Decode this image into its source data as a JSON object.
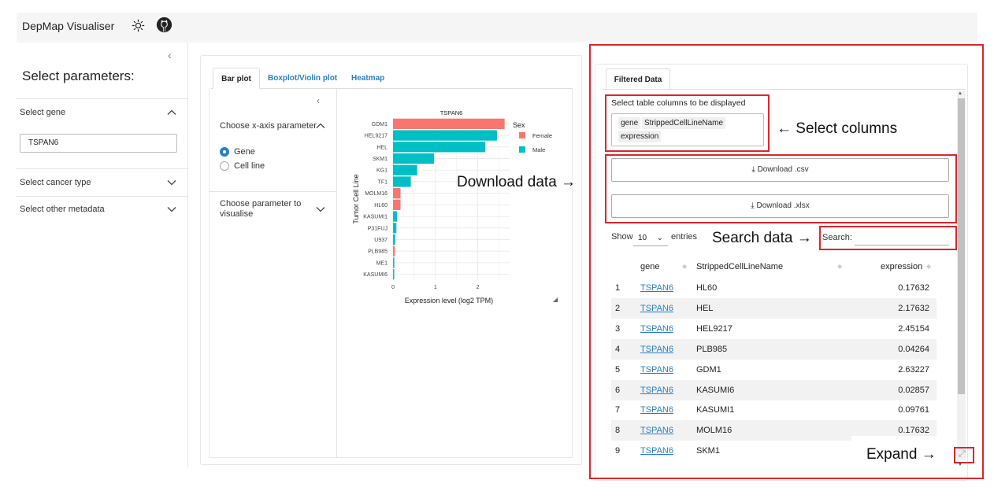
{
  "header": {
    "app_title": "DepMap Visualiser",
    "theme_icon": "sun-icon",
    "repo_icon": "github-icon"
  },
  "sidebar": {
    "heading": "Select parameters:",
    "gene_section": {
      "label": "Select gene",
      "value": "TSPAN6"
    },
    "cancer_section": {
      "label": "Select cancer type"
    },
    "metadata_section": {
      "label": "Select other metadata"
    }
  },
  "plot_panel": {
    "tabs": [
      "Bar plot",
      "Boxplot/Violin plot",
      "Heatmap"
    ],
    "active_tab": "Bar plot",
    "xaxis_option_label": "Choose x-axis parameter",
    "xaxis_options": [
      "Gene",
      "Cell line"
    ],
    "xaxis_selected": "Gene",
    "visualise_label": "Choose parameter to visualise"
  },
  "chart_data": {
    "type": "bar",
    "orientation": "horizontal",
    "title": "TSPAN6",
    "xlabel": "Expression level (log2 TPM)",
    "ylabel": "Tumor Cell Line",
    "xlim": [
      0,
      2.75
    ],
    "xticks": [
      "0",
      "1",
      "2"
    ],
    "categories": [
      "GDM1",
      "HEL9217",
      "HEL",
      "SKM1",
      "KG1",
      "TF1",
      "MOLM16",
      "HL60",
      "KASUMI1",
      "P31FUJ",
      "U937",
      "PLB985",
      "ME1",
      "KASUMI6"
    ],
    "values": [
      2.63227,
      2.45154,
      2.17632,
      0.97,
      0.57,
      0.42,
      0.17632,
      0.17632,
      0.09761,
      0.08,
      0.05,
      0.04264,
      0.03,
      0.02857
    ],
    "groups": [
      "Female",
      "Male",
      "Male",
      "Male",
      "Male",
      "Male",
      "Female",
      "Female",
      "Male",
      "Male",
      "Male",
      "Female",
      "Male",
      "Male"
    ],
    "legend": {
      "title": "Sex",
      "position": "right",
      "items": [
        {
          "name": "Female",
          "color": "#f8766d"
        },
        {
          "name": "Male",
          "color": "#00bfc4"
        }
      ]
    },
    "grid": true
  },
  "data_panel": {
    "tab": "Filtered Data",
    "columns_label": "Select table columns to be displayed",
    "selected_columns": [
      "gene",
      "StrippedCellLineName",
      "expression"
    ],
    "download_csv": "Download .csv",
    "download_xlsx": "Download .xlsx",
    "show_label": "Show",
    "entries_value": "10",
    "entries_label": "entries",
    "search_label": "Search:",
    "search_value": "",
    "table": {
      "headers": [
        "gene",
        "StrippedCellLineName",
        "expression"
      ],
      "rows": [
        {
          "idx": "1",
          "gene": "TSPAN6",
          "cell_line": "HL60",
          "expression": "0.17632"
        },
        {
          "idx": "2",
          "gene": "TSPAN6",
          "cell_line": "HEL",
          "expression": "2.17632"
        },
        {
          "idx": "3",
          "gene": "TSPAN6",
          "cell_line": "HEL9217",
          "expression": "2.45154"
        },
        {
          "idx": "4",
          "gene": "TSPAN6",
          "cell_line": "PLB985",
          "expression": "0.04264"
        },
        {
          "idx": "5",
          "gene": "TSPAN6",
          "cell_line": "GDM1",
          "expression": "2.63227"
        },
        {
          "idx": "6",
          "gene": "TSPAN6",
          "cell_line": "KASUMI6",
          "expression": "0.02857"
        },
        {
          "idx": "7",
          "gene": "TSPAN6",
          "cell_line": "KASUMI1",
          "expression": "0.09761"
        },
        {
          "idx": "8",
          "gene": "TSPAN6",
          "cell_line": "MOLM16",
          "expression": "0.17632"
        },
        {
          "idx": "9",
          "gene": "TSPAN6",
          "cell_line": "SKM1",
          "expression": ""
        }
      ]
    }
  },
  "annotations": {
    "select_columns": "← Select columns",
    "download_data": "Download data →",
    "search_data": "Search data →",
    "expand": "Expand →"
  },
  "colors": {
    "accent": "#2a7fc0",
    "highlight_red": "#d9262d",
    "female": "#f8766d",
    "male": "#00bfc4"
  }
}
